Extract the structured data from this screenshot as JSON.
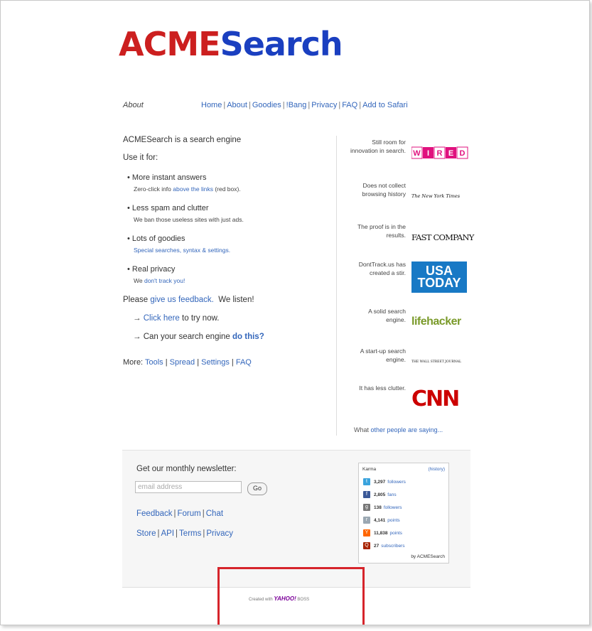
{
  "logo": {
    "part1": "ACME",
    "part2": "Search"
  },
  "nav": {
    "current": "About",
    "items": [
      "Home",
      "About",
      "Goodies",
      "!Bang",
      "Privacy",
      "FAQ",
      "Add to Safari"
    ]
  },
  "intro": {
    "headline": "ACMESearch is a search engine",
    "use_for": "Use it for:"
  },
  "bullets": [
    {
      "title": "• More instant answers",
      "sub_pre": "Zero-click info ",
      "sub_link": "above the links",
      "sub_post": " (red box)."
    },
    {
      "title": "• Less spam and clutter",
      "sub_pre": "We ban those useless sites with just ads.",
      "sub_link": "",
      "sub_post": ""
    },
    {
      "title": "• Lots of goodies",
      "sub_pre": "",
      "sub_link": "Special searches, syntax & settings.",
      "sub_post": ""
    },
    {
      "title": "• Real privacy",
      "sub_pre": "We ",
      "sub_link": "don't track you!",
      "sub_post": ""
    }
  ],
  "feedback": {
    "pre": "Please ",
    "link": "give us feedback.",
    "post": "  We listen!"
  },
  "cta1": {
    "arrow": "→ ",
    "link": "Click here",
    "post": " to try now."
  },
  "cta2": {
    "arrow": "→ ",
    "pre": "Can your search engine ",
    "link": "do this?"
  },
  "more": {
    "label": "More:",
    "links": [
      "Tools",
      "Spread",
      "Settings",
      "FAQ"
    ]
  },
  "press": [
    {
      "quote": "Still room for innovation in search.",
      "source": "WIRED"
    },
    {
      "quote": "Does not collect browsing history",
      "source": "The New York Times"
    },
    {
      "quote": "The proof is in the results.",
      "source": "FAST COMPANY"
    },
    {
      "quote": "DontTrack.us has created a stir.",
      "source_line1": "USA",
      "source_line2": "TODAY"
    },
    {
      "quote": "A solid search engine.",
      "source": "lifehacker"
    },
    {
      "quote": "A start-up search engine.",
      "source": "THE WALL STREET JOURNAL"
    },
    {
      "quote": "It has less clutter.",
      "source": "CNN"
    }
  ],
  "others": {
    "pre": "What ",
    "link": "other people are saying...",
    "post": ""
  },
  "newsletter": {
    "title": "Get our monthly newsletter:",
    "placeholder": "email address",
    "button": "Go"
  },
  "footer_links1": [
    "Feedback",
    "Forum",
    "Chat"
  ],
  "footer_links2": [
    "Store",
    "API",
    "Terms",
    "Privacy"
  ],
  "karma": {
    "title": "Karma",
    "history": "(history)",
    "rows": [
      {
        "icon": "twitter-icon",
        "color": "#3aa3dd",
        "count": "3,297",
        "label": "followers"
      },
      {
        "icon": "facebook-icon",
        "color": "#3b5998",
        "count": "2,805",
        "label": "fans"
      },
      {
        "icon": "googleplus-icon",
        "color": "#777777",
        "count": "138",
        "label": "followers"
      },
      {
        "icon": "reddit-icon",
        "color": "#9aa7b2",
        "count": "4,141",
        "label": "points"
      },
      {
        "icon": "hackernews-icon",
        "color": "#ff6600",
        "count": "11,838",
        "label": "points"
      },
      {
        "icon": "quora-icon",
        "color": "#a82400",
        "count": "27",
        "label": "subscribers"
      }
    ],
    "by": "by ACMESearch"
  },
  "created": {
    "pre": "Created with ",
    "brand": "YAHOO!",
    "post": " BOSS"
  },
  "colors": {
    "logo_red": "#cc1f1f",
    "logo_blue": "#1a3fc0",
    "link": "#3366bb",
    "highlight": "#d6242b"
  }
}
